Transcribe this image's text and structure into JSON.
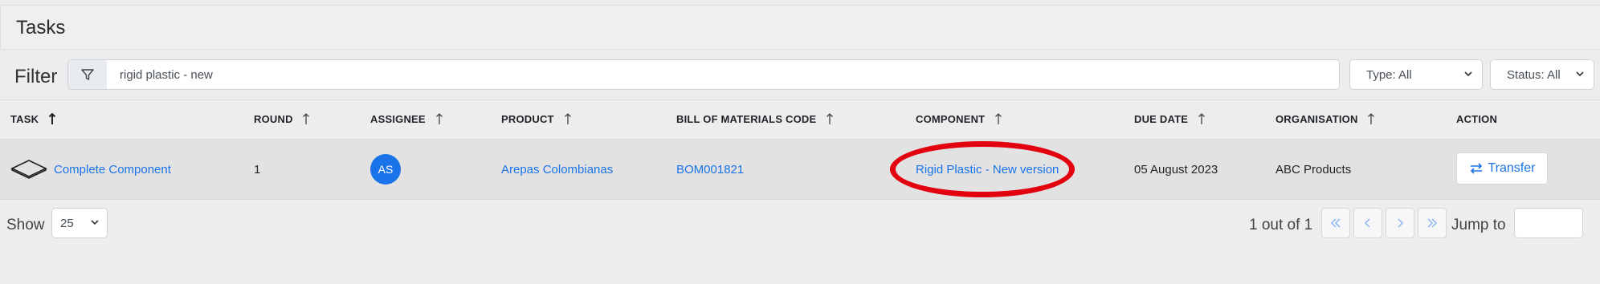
{
  "header": {
    "title": "Tasks"
  },
  "filter": {
    "label": "Filter",
    "value": "rigid plastic - new",
    "type_select": "Type: All",
    "status_select": "Status: All"
  },
  "table": {
    "columns": [
      "TASK",
      "ROUND",
      "ASSIGNEE",
      "PRODUCT",
      "BILL OF MATERIALS CODE",
      "COMPONENT",
      "DUE DATE",
      "ORGANISATION",
      "ACTION"
    ],
    "rows": [
      {
        "task": "Complete Component",
        "round": "1",
        "assignee": "AS",
        "product": "Arepas Colombianas",
        "bom_code": "BOM001821",
        "component": "Rigid Plastic - New version",
        "due_date": "05 August 2023",
        "organisation": "ABC Products",
        "action": "Transfer"
      }
    ]
  },
  "footer": {
    "show_label": "Show",
    "page_size": "25",
    "pager_text": "1 out of 1",
    "jump_label": "Jump to",
    "jump_value": ""
  },
  "colors": {
    "link": "#1a73e8",
    "highlight": "#e3000f",
    "avatar": "#1a73e8"
  },
  "icons": [
    "filter-icon",
    "chevron-down-icon",
    "sort-arrow-icon",
    "task-shape-icon",
    "transfer-arrows-icon",
    "first-page-icon",
    "prev-page-icon",
    "next-page-icon",
    "last-page-icon"
  ]
}
